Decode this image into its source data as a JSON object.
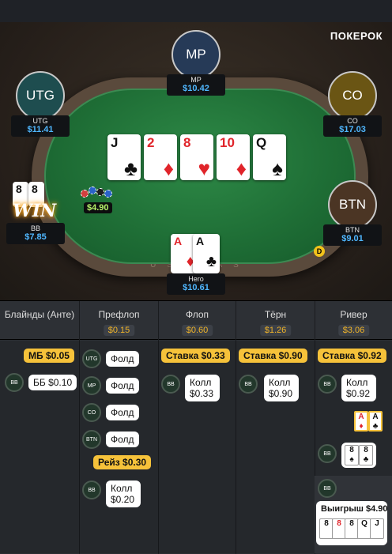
{
  "brand": "ПОКЕРОК",
  "seats": [
    {
      "id": "mp",
      "avatar": "MP",
      "name": "MP",
      "stack": "$10.42",
      "color": "#263a57"
    },
    {
      "id": "utg",
      "avatar": "UTG",
      "name": "UTG",
      "stack": "$11.41",
      "color": "#1e4d4f"
    },
    {
      "id": "co",
      "avatar": "CO",
      "name": "CO",
      "stack": "$17.03",
      "color": "#6a5514"
    },
    {
      "id": "btn",
      "avatar": "BTN",
      "name": "BTN",
      "stack": "$9.01",
      "color": "#4b3524"
    },
    {
      "id": "bb",
      "name": "BB",
      "stack": "$7.85"
    },
    {
      "id": "hero",
      "name": "Hero",
      "stack": "$10.61"
    }
  ],
  "board": [
    {
      "rank": "J",
      "suit": "♣",
      "color": "blk"
    },
    {
      "rank": "2",
      "suit": "♦",
      "color": "red"
    },
    {
      "rank": "8",
      "suit": "♥",
      "color": "red"
    },
    {
      "rank": "10",
      "suit": "♦",
      "color": "red"
    },
    {
      "rank": "Q",
      "suit": "♠",
      "color": "blk"
    }
  ],
  "hero_cards": [
    {
      "rank": "A",
      "suit": "♦",
      "color": "red"
    },
    {
      "rank": "A",
      "suit": "♣",
      "color": "blk"
    }
  ],
  "bb_cards": [
    {
      "rank": "8",
      "suit": "♠"
    },
    {
      "rank": "8",
      "suit": "♣"
    }
  ],
  "win_label": "WIN",
  "pot_on_table": "$4.90",
  "dealer": "D",
  "rim_text": "USHCAS",
  "history": {
    "columns": [
      {
        "title": "Блайнды (Анте)",
        "pot": ""
      },
      {
        "title": "Префлоп",
        "pot": "$0.15"
      },
      {
        "title": "Флоп",
        "pot": "$0.60"
      },
      {
        "title": "Тёрн",
        "pot": "$1.26"
      },
      {
        "title": "Ривер",
        "pot": "$3.06"
      }
    ],
    "blinds": {
      "sb": "МБ $0.05",
      "bb_pos": "BB",
      "bb": "ББ $0.10"
    },
    "preflop": {
      "utg": "UTG",
      "utg_act": "Фолд",
      "mp": "MP",
      "mp_act": "Фолд",
      "co": "CO",
      "co_act": "Фолд",
      "btn": "BTN",
      "btn_act": "Фолд",
      "raise": "Рейз $0.30",
      "bb": "BB",
      "bb_act_1": "Колл",
      "bb_act_2": "$0.20"
    },
    "flop": {
      "bet": "Ставка $0.33",
      "bb": "BB",
      "call_1": "Колл",
      "call_2": "$0.33"
    },
    "turn": {
      "bet": "Ставка $0.90",
      "bb": "BB",
      "call_1": "Колл",
      "call_2": "$0.90"
    },
    "river": {
      "bet": "Ставка $0.92",
      "bb": "BB",
      "call_1": "Колл",
      "call_2": "$0.92",
      "show_bb": "BB",
      "win_bb": "BB",
      "win": "Выигрыш $4.90"
    }
  }
}
